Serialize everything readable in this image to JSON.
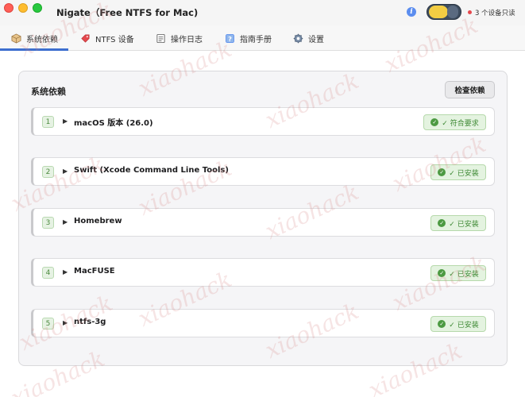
{
  "window": {
    "title": "Nigate（Free NTFS for Mac)",
    "status_text": "3 个设备只读",
    "status_color": "#e5484d",
    "accent": "#3d6fcf"
  },
  "tabs": [
    {
      "label": "系统依赖",
      "icon": "package-icon",
      "active": true
    },
    {
      "label": "NTFS 设备",
      "icon": "tag-icon",
      "active": false
    },
    {
      "label": "操作日志",
      "icon": "log-icon",
      "active": false
    },
    {
      "label": "指南手册",
      "icon": "help-icon",
      "active": false
    },
    {
      "label": "设置",
      "icon": "gear-icon",
      "active": false
    }
  ],
  "panel": {
    "title": "系统依赖",
    "check_button": "检查依赖"
  },
  "dependencies": [
    {
      "index": "1",
      "name": "macOS 版本 (26.0)",
      "status": "✓ 符合要求"
    },
    {
      "index": "2",
      "name": "Swift (Xcode Command Line Tools)",
      "status": "✓ 已安装"
    },
    {
      "index": "3",
      "name": "Homebrew",
      "status": "✓ 已安装"
    },
    {
      "index": "4",
      "name": "MacFUSE",
      "status": "✓ 已安装"
    },
    {
      "index": "5",
      "name": "ntfs-3g",
      "status": "✓ 已安装"
    }
  ],
  "watermark": "xiaohack"
}
